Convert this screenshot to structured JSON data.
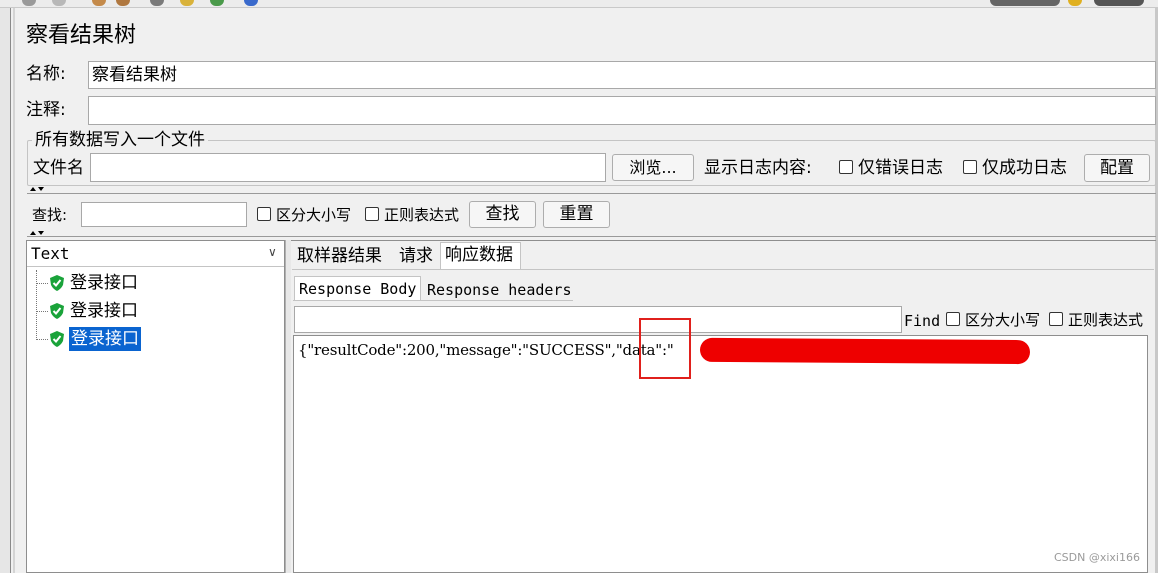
{
  "window": {
    "title": "察看结果树"
  },
  "form": {
    "name_label": "名称:",
    "name_value": "察看结果树",
    "comment_label": "注释:",
    "comment_value": "",
    "file_group_title": "所有数据写入一个文件",
    "file_label": "文件名",
    "file_value": "",
    "browse_label": "浏览...",
    "log_display_label": "显示日志内容:",
    "errors_only_label": "仅错误日志",
    "success_only_label": "仅成功日志",
    "configure_label": "配置"
  },
  "search": {
    "label": "查找:",
    "value": "",
    "case_sensitive_label": "区分大小写",
    "regex_label": "正则表达式",
    "find_label": "查找",
    "reset_label": "重置"
  },
  "tree": {
    "renderer_selected": "Text",
    "items": [
      {
        "label": "登录接口",
        "selected": false,
        "status": "success"
      },
      {
        "label": "登录接口",
        "selected": false,
        "status": "success"
      },
      {
        "label": "登录接口",
        "selected": true,
        "status": "success"
      }
    ]
  },
  "result": {
    "tabs": [
      {
        "label": "取样器结果",
        "active": false
      },
      {
        "label": "请求",
        "active": false
      },
      {
        "label": "响应数据",
        "active": true
      }
    ],
    "subtabs": [
      {
        "label": "Response Body",
        "active": true
      },
      {
        "label": "Response headers",
        "active": false
      }
    ],
    "find_value": "",
    "find_label": "Find",
    "case_sensitive_label": "区分大小写",
    "regex_label": "正则表达式",
    "response_text": "{\"resultCode\":200,\"message\":\"SUCCESS\",\"data\":\""
  },
  "watermark": "CSDN @xixi166",
  "colors": {
    "selection": "#0a64d0",
    "success_shield": "#1aa33a",
    "annotation_box": "#e0201c",
    "redaction": "#ee0000"
  }
}
